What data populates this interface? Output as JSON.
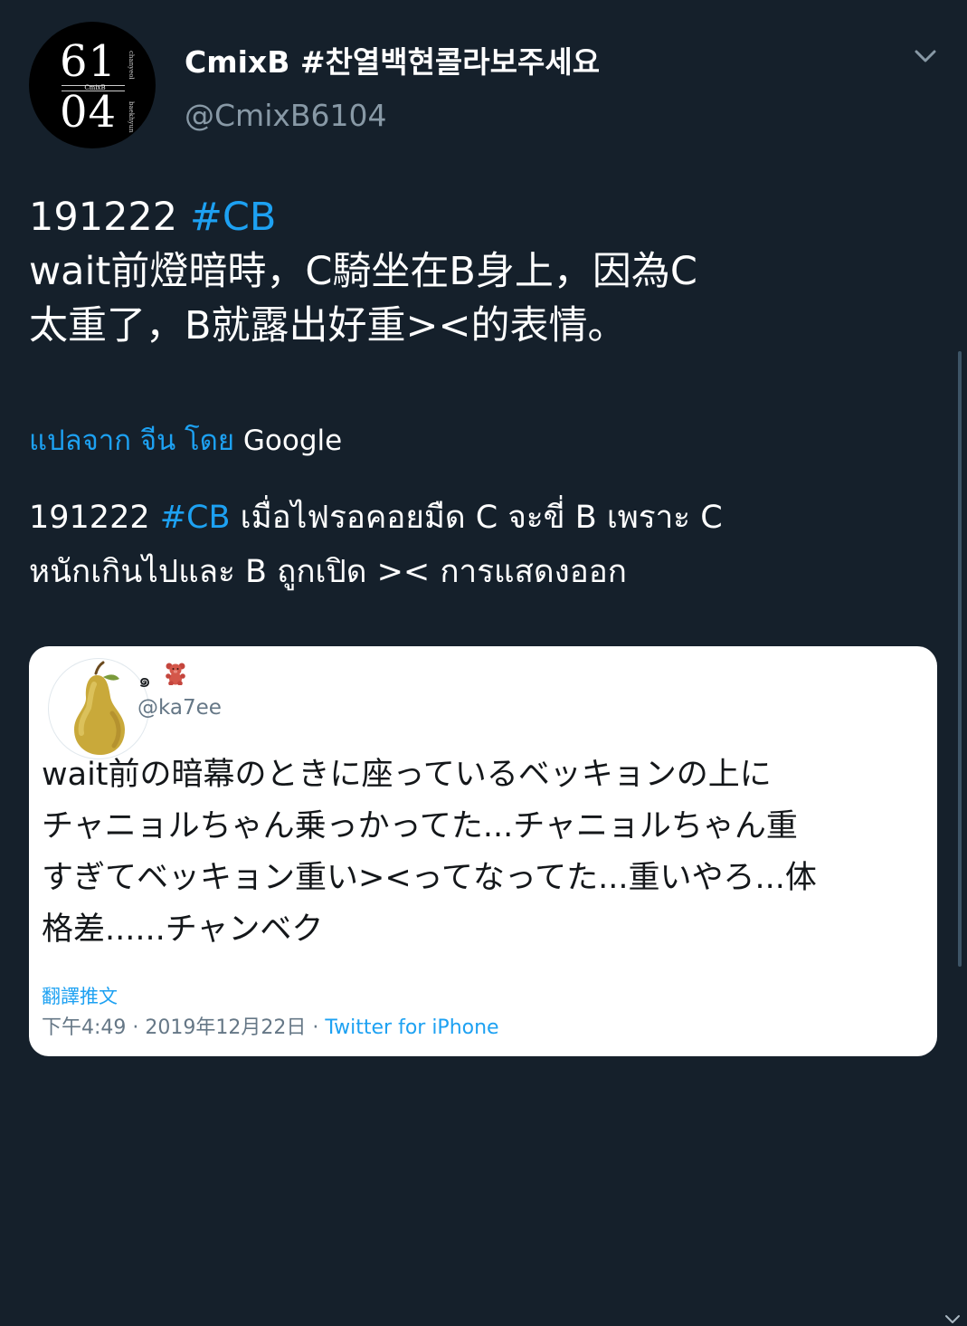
{
  "author": {
    "display_name": "CmixB #찬열백현콜라보주세요",
    "handle": "@CmixB6104",
    "avatar": {
      "top_number": "61",
      "bottom_number": "04",
      "center_text": "CmixB",
      "side_text_top": "chanyeol",
      "side_text_bottom": "baekhyun"
    }
  },
  "tweet": {
    "lines": [
      {
        "prefix": "191222 ",
        "hashtag": "#CB",
        "suffix": ""
      },
      {
        "prefix": "wait前燈暗時，C騎坐在B身上，因為C",
        "hashtag": "",
        "suffix": ""
      },
      {
        "prefix": "太重了，B就露出好重><的表情。",
        "hashtag": "",
        "suffix": ""
      }
    ]
  },
  "translation_notice": {
    "link_text": "แปลจาก จีน โดย",
    "provider": "Google"
  },
  "translation": {
    "lines": [
      {
        "prefix": "191222 ",
        "hashtag": "#CB",
        "suffix": " เมื่อไฟรอคอยมืด C จะขี่ B เพราะ C"
      },
      {
        "prefix": "หนักเกินไปและ B ถูกเปิด >< การแสดงออก",
        "hashtag": "",
        "suffix": ""
      }
    ]
  },
  "quoted_tweet": {
    "name": "๑",
    "handle": "@ka7ee",
    "avatar_icon": "pear-icon",
    "name_icon": "teddy-bear-icon",
    "text_lines": [
      "wait前の暗幕のときに座っているベッキョンの上に",
      "チャニョルちゃん乗っかってた...チャニョルちゃん重",
      "すぎてベッキョン重い><ってなってた...重いやろ...体",
      "格差......チャンベク"
    ],
    "translate_label": "翻譯推文",
    "timestamp": "下午4:49 · 2019年12月22日 · ",
    "source": "Twitter for iPhone"
  },
  "colors": {
    "background": "#15202b",
    "accent": "#1da1f2",
    "secondary_text": "#8899a6",
    "card_background": "#ffffff"
  }
}
